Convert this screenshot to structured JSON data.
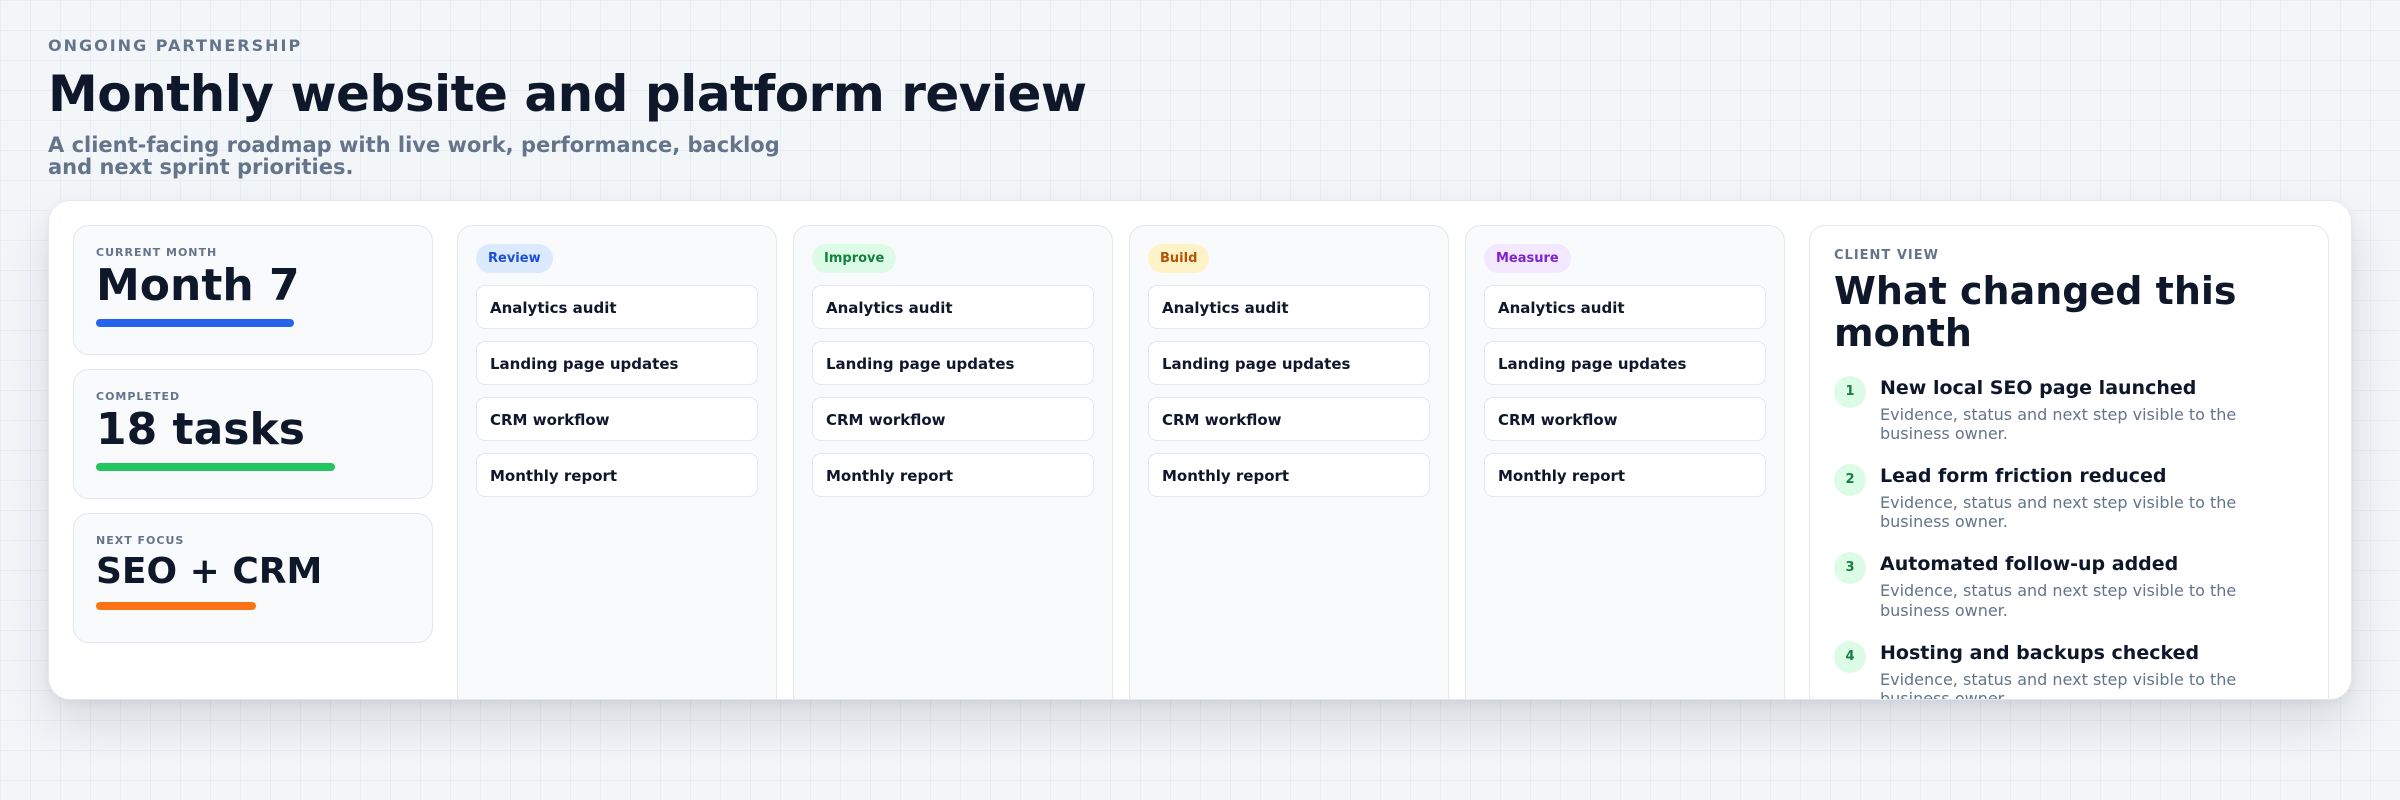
{
  "header": {
    "eyebrow": "ONGOING PARTNERSHIP",
    "title": "Monthly website and platform review",
    "subtitle": "A client-facing roadmap with live work, performance, backlog and next sprint priorities."
  },
  "stats": [
    {
      "label": "CURRENT MONTH",
      "value": "Month 7",
      "color": "#2563eb",
      "progress": 0.63
    },
    {
      "label": "COMPLETED",
      "value": "18 tasks",
      "color": "#22c55e",
      "progress": 0.76
    },
    {
      "label": "NEXT FOCUS",
      "value": "SEO + CRM",
      "color": "#f97316",
      "progress": 0.51
    }
  ],
  "columns": [
    {
      "label": "Review",
      "pill_bg": "#dbeafe",
      "pill_fg": "#1d4ed8",
      "tasks": [
        "Analytics audit",
        "Landing page updates",
        "CRM workflow",
        "Monthly report"
      ]
    },
    {
      "label": "Improve",
      "pill_bg": "#dcfce7",
      "pill_fg": "#15803d",
      "tasks": [
        "Analytics audit",
        "Landing page updates",
        "CRM workflow",
        "Monthly report"
      ]
    },
    {
      "label": "Build",
      "pill_bg": "#fef3c7",
      "pill_fg": "#b45309",
      "tasks": [
        "Analytics audit",
        "Landing page updates",
        "CRM workflow",
        "Monthly report"
      ]
    },
    {
      "label": "Measure",
      "pill_bg": "#f3e8ff",
      "pill_fg": "#7e22ce",
      "tasks": [
        "Analytics audit",
        "Landing page updates",
        "CRM workflow",
        "Monthly report"
      ]
    }
  ],
  "client": {
    "label": "CLIENT VIEW",
    "title": "What changed this month",
    "changes": [
      {
        "num": "1",
        "title": "New local SEO page launched",
        "desc": "Evidence, status and next step visible to the business owner."
      },
      {
        "num": "2",
        "title": "Lead form friction reduced",
        "desc": "Evidence, status and next step visible to the business owner."
      },
      {
        "num": "3",
        "title": "Automated follow-up added",
        "desc": "Evidence, status and next step visible to the business owner."
      },
      {
        "num": "4",
        "title": "Hosting and backups checked",
        "desc": "Evidence, status and next step visible to the business owner."
      }
    ]
  }
}
